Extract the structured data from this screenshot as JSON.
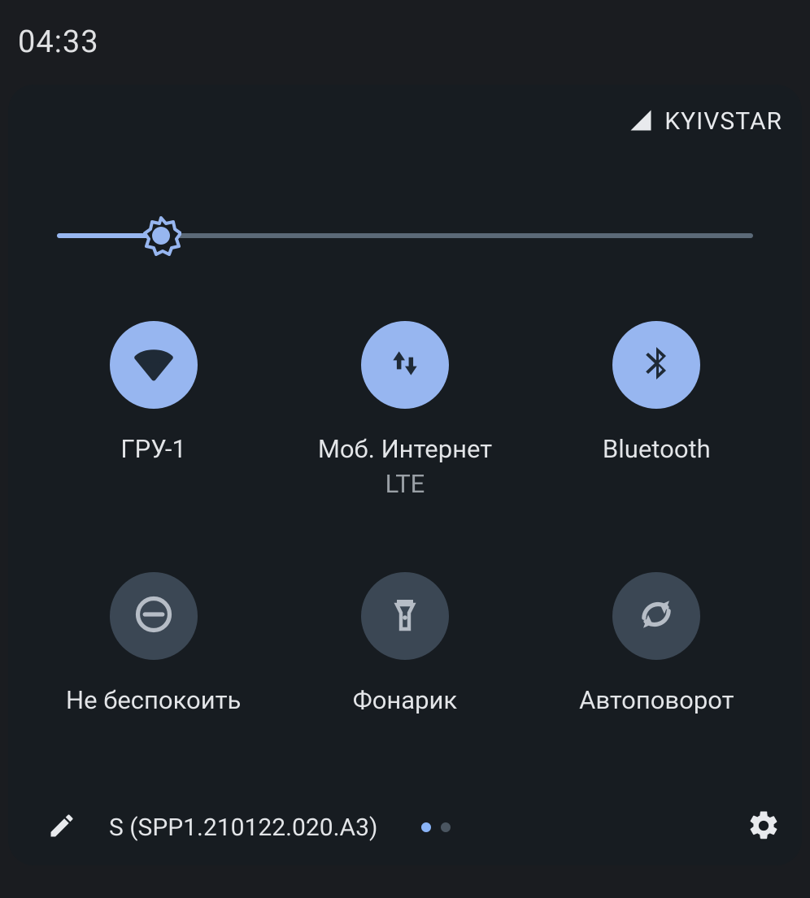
{
  "status": {
    "time": "04:33"
  },
  "carrier": {
    "name": "KYIVSTAR"
  },
  "brightness": {
    "percent": 15
  },
  "tiles": [
    {
      "id": "wifi",
      "label": "ГРУ-1",
      "sublabel": "",
      "active": true
    },
    {
      "id": "mobiledata",
      "label": "Моб. Интернет",
      "sublabel": "LTE",
      "active": true
    },
    {
      "id": "bluetooth",
      "label": "Bluetooth",
      "sublabel": "",
      "active": true
    },
    {
      "id": "dnd",
      "label": "Не беспокоить",
      "sublabel": "",
      "active": false
    },
    {
      "id": "flashlight",
      "label": "Фонарик",
      "sublabel": "",
      "active": false
    },
    {
      "id": "autorotate",
      "label": "Автоповорот",
      "sublabel": "",
      "active": false
    }
  ],
  "footer": {
    "build": "S (SPP1.210122.020.A3)",
    "pages": {
      "count": 2,
      "active": 0
    }
  }
}
